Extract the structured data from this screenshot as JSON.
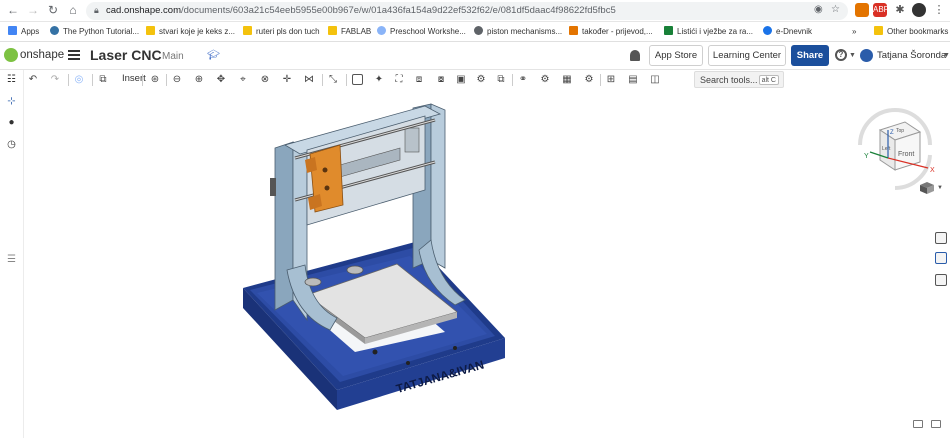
{
  "browser": {
    "url_host": "cad.onshape.com",
    "url_path": "/documents/603a21c54eeb5955e00b967e/w/01a436fa154a9d22ef532f62/e/081df5daac4f98622fd5fbc5"
  },
  "bookmarks": [
    {
      "label": "Apps",
      "color": "#4285f4"
    },
    {
      "label": "The Python Tutorial...",
      "color": "#3572a5"
    },
    {
      "label": "stvari koje je keks z...",
      "color": "#f4c20d"
    },
    {
      "label": "ruteri pls don tuch",
      "color": "#f4c20d"
    },
    {
      "label": "FABLAB",
      "color": "#f4c20d"
    },
    {
      "label": "Preschool Workshe...",
      "color": "#8ab4f8"
    },
    {
      "label": "piston mechanisms...",
      "color": "#5f6368"
    },
    {
      "label": "također - prijevod,...",
      "color": "#e37400"
    },
    {
      "label": "Listići i vježbe za ra...",
      "color": "#188038"
    },
    {
      "label": "e-Dnevnik",
      "color": "#1a73e8"
    },
    {
      "label": "»",
      "color": ""
    },
    {
      "label": "Other bookmarks",
      "color": "#f4c20d"
    }
  ],
  "app": {
    "logo_text": "onshape",
    "doc_name": "Laser CNC",
    "branch": "Main",
    "app_store": "App Store",
    "learning_center": "Learning Center",
    "share": "Share",
    "user": "Tatjana Šoronda"
  },
  "toolbar": {
    "insert": "Insert",
    "search_placeholder": "Search tools...",
    "search_shortcut": "alt C"
  },
  "viewcube": {
    "front": "Front",
    "top": "Top",
    "left": "Left",
    "axis_x": "X",
    "axis_y": "Y",
    "axis_z": "Z"
  },
  "model": {
    "engraving": "TATJANA&IVAN",
    "colors": {
      "base_blue": "#2d4ca5",
      "frame_steel": "#9fb8cc",
      "carriage_orange": "#e08b2c",
      "bed_gray": "#d9d9d9"
    }
  }
}
